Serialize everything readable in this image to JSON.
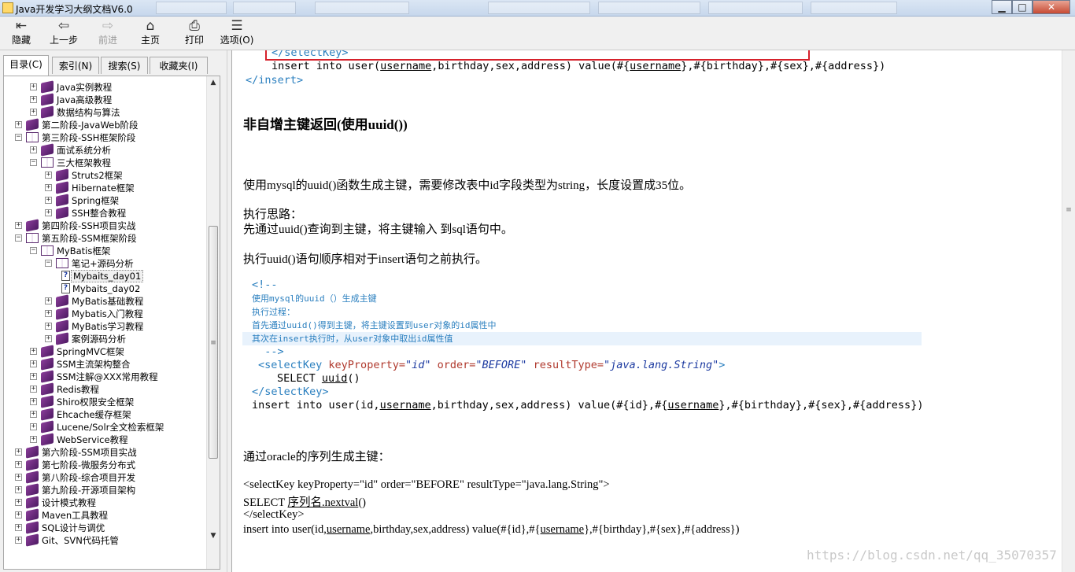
{
  "window": {
    "title": "Java开发学习大纲文档V6.0",
    "minimize": "▁",
    "maximize": "□",
    "close": "✕"
  },
  "toolbar": {
    "buttons": [
      {
        "label": "隐藏",
        "icon": "hide-icon",
        "glyph": "⇤"
      },
      {
        "label": "上一步",
        "icon": "back-arrow-icon",
        "glyph": "⇦"
      },
      {
        "label": "前进",
        "icon": "forward-arrow-icon",
        "glyph": "⇨",
        "disabled": true
      },
      {
        "label": "主页",
        "icon": "home-icon",
        "glyph": "⌂"
      },
      {
        "label": "打印",
        "icon": "printer-icon",
        "glyph": "⎙"
      },
      {
        "label": "选项(O)",
        "icon": "options-icon",
        "glyph": "☰"
      }
    ]
  },
  "tabs": [
    {
      "label": "目录(C)",
      "active": true
    },
    {
      "label": "索引(N)"
    },
    {
      "label": "搜索(S)"
    },
    {
      "label": "收藏夹(I)"
    }
  ],
  "tree": [
    {
      "label": "Java实例教程",
      "level": 1,
      "type": "book",
      "expander": "+"
    },
    {
      "label": "Java高级教程",
      "level": 1,
      "type": "book",
      "expander": "+"
    },
    {
      "label": "数据结构与算法",
      "level": 1,
      "type": "book",
      "expander": "+"
    },
    {
      "label": "第二阶段-JavaWeb阶段",
      "level": 0,
      "type": "book",
      "expander": "+"
    },
    {
      "label": "第三阶段-SSH框架阶段",
      "level": 0,
      "type": "open",
      "expander": "−"
    },
    {
      "label": "面试系统分析",
      "level": 1,
      "type": "book",
      "expander": "+"
    },
    {
      "label": "三大框架教程",
      "level": 1,
      "type": "open",
      "expander": "−"
    },
    {
      "label": "Struts2框架",
      "level": 2,
      "type": "book",
      "expander": "+"
    },
    {
      "label": "Hibernate框架",
      "level": 2,
      "type": "book",
      "expander": "+"
    },
    {
      "label": "Spring框架",
      "level": 2,
      "type": "book",
      "expander": "+"
    },
    {
      "label": "SSH整合教程",
      "level": 2,
      "type": "book",
      "expander": "+"
    },
    {
      "label": "第四阶段-SSH项目实战",
      "level": 0,
      "type": "book",
      "expander": "+"
    },
    {
      "label": "第五阶段-SSM框架阶段",
      "level": 0,
      "type": "open",
      "expander": "−"
    },
    {
      "label": "MyBatis框架",
      "level": 1,
      "type": "open",
      "expander": "−"
    },
    {
      "label": "笔记+源码分析",
      "level": 2,
      "type": "open",
      "expander": "−"
    },
    {
      "label": "Mybaits_day01",
      "level": 3,
      "type": "page",
      "selected": true
    },
    {
      "label": "Mybaits_day02",
      "level": 3,
      "type": "page"
    },
    {
      "label": "MyBatis基础教程",
      "level": 2,
      "type": "book",
      "expander": "+"
    },
    {
      "label": "Mybatis入门教程",
      "level": 2,
      "type": "book",
      "expander": "+"
    },
    {
      "label": "MyBatis学习教程",
      "level": 2,
      "type": "book",
      "expander": "+"
    },
    {
      "label": "案例源码分析",
      "level": 2,
      "type": "book",
      "expander": "+"
    },
    {
      "label": "SpringMVC框架",
      "level": 1,
      "type": "book",
      "expander": "+"
    },
    {
      "label": "SSM主流架构整合",
      "level": 1,
      "type": "book",
      "expander": "+"
    },
    {
      "label": "SSM注解@XXX常用教程",
      "level": 1,
      "type": "book",
      "expander": "+"
    },
    {
      "label": "Redis教程",
      "level": 1,
      "type": "book",
      "expander": "+"
    },
    {
      "label": "Shiro权限安全框架",
      "level": 1,
      "type": "book",
      "expander": "+"
    },
    {
      "label": "Ehcache缓存框架",
      "level": 1,
      "type": "book",
      "expander": "+"
    },
    {
      "label": "Lucene/Solr全文检索框架",
      "level": 1,
      "type": "book",
      "expander": "+"
    },
    {
      "label": "WebService教程",
      "level": 1,
      "type": "book",
      "expander": "+"
    },
    {
      "label": "第六阶段-SSM项目实战",
      "level": 0,
      "type": "book",
      "expander": "+"
    },
    {
      "label": "第七阶段-微服务分布式",
      "level": 0,
      "type": "book",
      "expander": "+"
    },
    {
      "label": "第八阶段-综合项目开发",
      "level": 0,
      "type": "book",
      "expander": "+"
    },
    {
      "label": "第九阶段-开源项目架构",
      "level": 0,
      "type": "book",
      "expander": "+"
    },
    {
      "label": "设计模式教程",
      "level": 0,
      "type": "book",
      "expander": "+"
    },
    {
      "label": "Maven工具教程",
      "level": 0,
      "type": "book",
      "expander": "+"
    },
    {
      "label": "SQL设计与调优",
      "level": 0,
      "type": "book",
      "expander": "+"
    },
    {
      "label": "Git、SVN代码托管",
      "level": 0,
      "type": "book",
      "expander": "+"
    }
  ],
  "content": {
    "top_code": {
      "close_selectkey": "</selectKey>",
      "insert_pre": "insert into user(",
      "insert_ul1": "username",
      "insert_mid": ",birthday,sex,address) value(#{",
      "insert_ul2": "username",
      "insert_post": "},#{birthday},#{sex},#{address})",
      "close_insert": "</insert>"
    },
    "heading": "非自增主键返回(使用uuid())",
    "para1": "使用mysql的uuid()函数生成主键，需要修改表中id字段类型为string，长度设置成35位。",
    "para2a": "执行思路：",
    "para2b": "先通过uuid()查询到主键，将主键输入 到sql语句中。",
    "para3": "执行uuid()语句顺序相对于insert语句之前执行。",
    "code_block": {
      "c1": "<!--",
      "c2": "使用mysql的uuid（）生成主键",
      "c3": "执行过程：",
      "c4": "首先通过uuid()得到主键，将主键设置到user对象的id属性中",
      "c5": "其次在insert执行时，从user对象中取出id属性值",
      "c6": "  -->",
      "sk_open": "<selectKey",
      "sk_attr1": "keyProperty=",
      "sk_val1": "\"id\"",
      "sk_attr2": "order=",
      "sk_val2": "\"BEFORE\"",
      "sk_attr3": "resultType=",
      "sk_val3": "\"java.lang.String\"",
      "sk_end": ">",
      "select_pre": "SELECT ",
      "select_ul": "uuid",
      "select_post": "()",
      "sk_close": "</selectKey>",
      "ins_pre": "insert into user(id,",
      "ins_ul1": "username",
      "ins_mid": ",birthday,sex,address) value(#{id},#{",
      "ins_ul2": "username",
      "ins_post": "},#{birthday},#{sex},#{address})"
    },
    "para4": "通过oracle的序列生成主键：",
    "oracle": {
      "l1": "<selectKey keyProperty=\"id\" order=\"BEFORE\" resultType=\"java.lang.String\">",
      "l2_pre": "SELECT ",
      "l2_ul": "序列名.nextval",
      "l2_post": "()",
      "l3": "</selectKey>",
      "l4_pre": "insert into user(id,",
      "l4_ul1": "username",
      "l4_mid": ",birthday,sex,address) value(#{id},#{",
      "l4_ul2": "username",
      "l4_post": "},#{birthday},#{sex},#{address})"
    },
    "watermark": "https://blog.csdn.net/qq_35070357"
  },
  "colors": {
    "tag": "#2a7fbf",
    "attribute": "#b0392d",
    "value": "#1c3aa0",
    "highlight_box": "#d6212b"
  }
}
